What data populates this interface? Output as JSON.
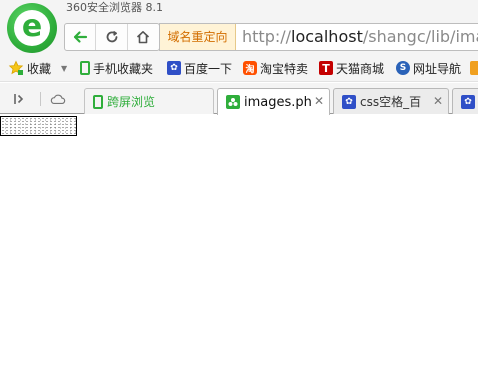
{
  "window": {
    "app_title": "360安全浏览器 8.1"
  },
  "toolbar": {
    "back_icon": "back-arrow-icon",
    "refresh_icon": "refresh-icon",
    "home_icon": "home-icon",
    "address_tag": "域名重定向",
    "url_scheme": "http://",
    "url_host": "localhost",
    "url_path": "/shangc/lib/images"
  },
  "bookmarks": {
    "favorites_label": "收藏",
    "items": [
      {
        "label": "手机收藏夹",
        "icon": "phone-icon"
      },
      {
        "label": "百度一下",
        "icon": "baidu-paw-icon"
      },
      {
        "label": "淘宝特卖",
        "icon": "taobao-icon"
      },
      {
        "label": "天猫商城",
        "icon": "tmall-icon"
      },
      {
        "label": "网址导航",
        "icon": "sogou-icon"
      }
    ]
  },
  "tabs": {
    "split_view_label": "跨屏浏览",
    "items": [
      {
        "label": "images.ph",
        "active": true
      },
      {
        "label": "css空格_百",
        "active": false
      }
    ]
  },
  "colors": {
    "brand_green": "#2fae3b",
    "address_tag_bg": "#fff3d6",
    "address_tag_text": "#d26e00"
  }
}
